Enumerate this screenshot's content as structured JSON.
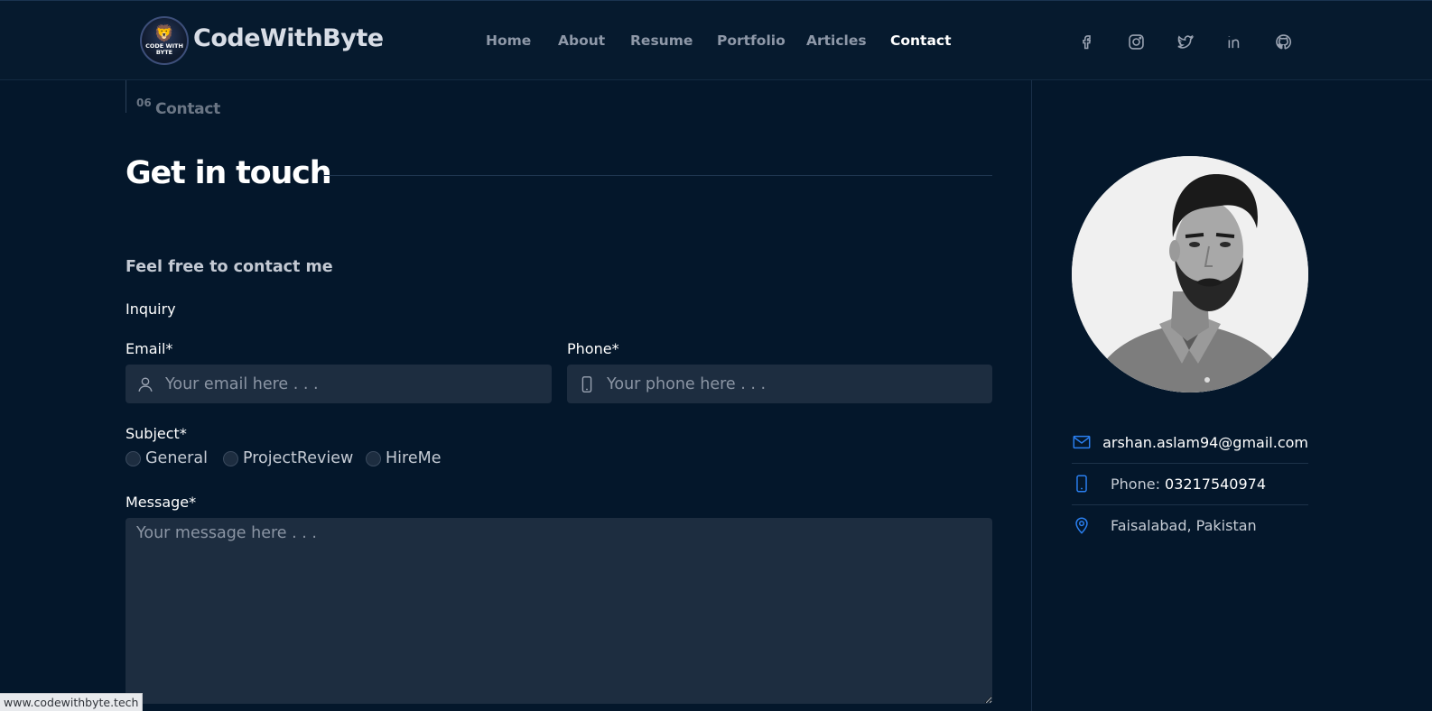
{
  "brand": {
    "name": "CodeWithByte",
    "logo_text_line1": "CODE WITH",
    "logo_text_line2": "BYTE"
  },
  "nav": {
    "items": [
      {
        "label": "Home"
      },
      {
        "label": "About"
      },
      {
        "label": "Resume"
      },
      {
        "label": "Portfolio"
      },
      {
        "label": "Articles"
      },
      {
        "label": "Contact",
        "active": true
      }
    ]
  },
  "social": [
    "facebook-icon",
    "instagram-icon",
    "twitter-icon",
    "linkedin-icon",
    "github-icon"
  ],
  "section": {
    "number": "06",
    "name": "Contact"
  },
  "main": {
    "title": "Get in touch",
    "subtitle": "Feel free to contact me",
    "inquiry": "Inquiry"
  },
  "form": {
    "email_label": "Email*",
    "email_placeholder": "Your email here . . .",
    "phone_label": "Phone*",
    "phone_placeholder": "Your phone here . . .",
    "subject_label": "Subject*",
    "subjects": [
      "General",
      "ProjectReview",
      "HireMe"
    ],
    "message_label": "Message*",
    "message_placeholder": "Your message here . . ."
  },
  "contact_info": {
    "email": "arshan.aslam94@gmail.com",
    "phone_prefix": "Phone: ",
    "phone": "03217540974",
    "location": "Faisalabad, Pakistan"
  },
  "status_bar": {
    "url": "www.codewithbyte.tech"
  },
  "colors": {
    "background": "#04172b",
    "header": "#061a2e",
    "field": "#1d2d40",
    "accent": "#2a7ff0"
  }
}
